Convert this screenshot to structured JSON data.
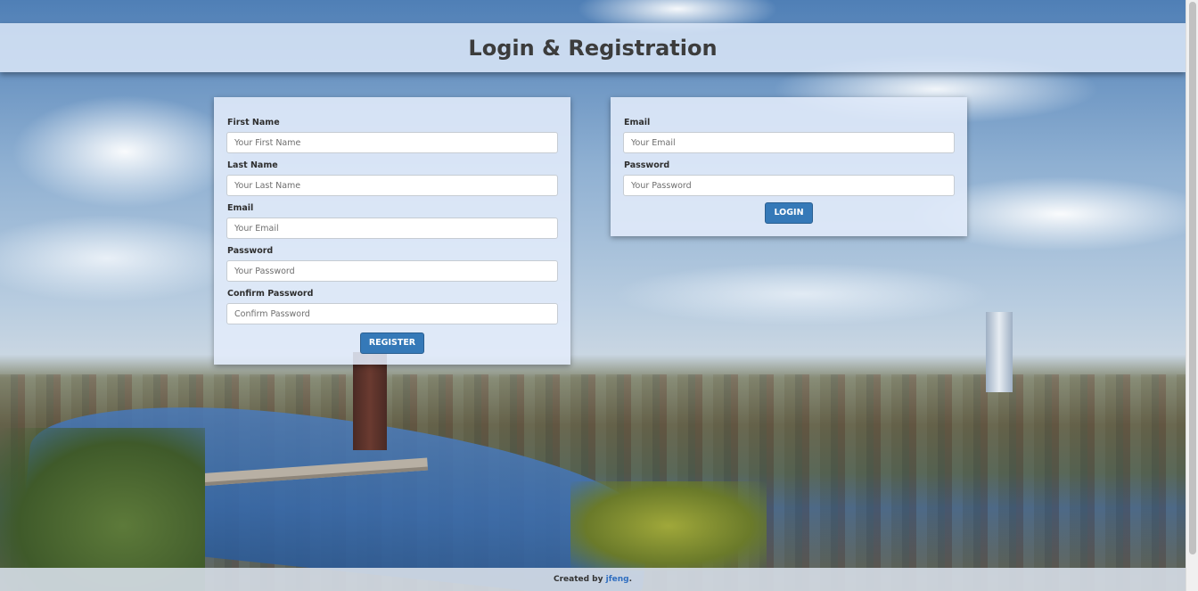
{
  "header": {
    "title": "Login & Registration"
  },
  "register": {
    "fields": [
      {
        "label": "First Name",
        "placeholder": "Your First Name"
      },
      {
        "label": "Last Name",
        "placeholder": "Your Last Name"
      },
      {
        "label": "Email",
        "placeholder": "Your Email"
      },
      {
        "label": "Password",
        "placeholder": "Your Password"
      },
      {
        "label": "Confirm Password",
        "placeholder": "Confirm Password"
      }
    ],
    "button_label": "REGISTER"
  },
  "login": {
    "fields": [
      {
        "label": "Email",
        "placeholder": "Your Email"
      },
      {
        "label": "Password",
        "placeholder": "Your Password"
      }
    ],
    "button_label": "LOGIN"
  },
  "footer": {
    "prefix": "Created by ",
    "author": "jfeng",
    "suffix": "."
  },
  "colors": {
    "accent": "#3579b8",
    "link": "#2f6ec0",
    "header_text": "#3c3c3c"
  }
}
